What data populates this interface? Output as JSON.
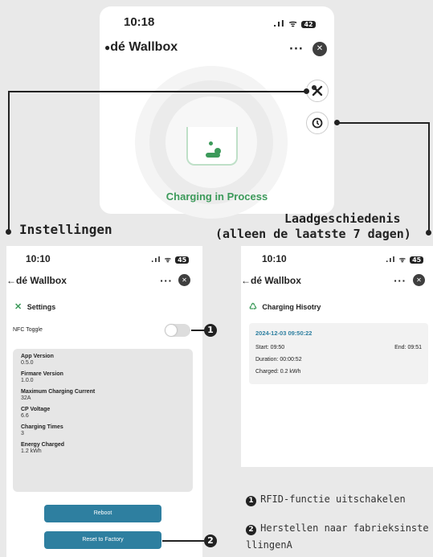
{
  "top_screen": {
    "time": "10:18",
    "battery": "42",
    "app_title": "dé Wallbox",
    "more": "···",
    "close": "✕",
    "status": "Charging in Process"
  },
  "annotations": {
    "settings_label": "Instellingen",
    "history_label_line1": "Laadgeschiedenis",
    "history_label_line2": "(alleen de laatste 7 dagen)"
  },
  "settings_screen": {
    "time": "10:10",
    "battery": "45",
    "app_title": "←dé Wallbox",
    "section_title": "Settings",
    "nfc_label": "NFC Toggle",
    "info": [
      {
        "label": "App Version",
        "value": "0.5.0"
      },
      {
        "label": "Firmare Version",
        "value": "1.0.0"
      },
      {
        "label": "Maximum Charging Current",
        "value": "32A"
      },
      {
        "label": "CP Voltage",
        "value": "6.6"
      },
      {
        "label": "Charging Times",
        "value": "3"
      },
      {
        "label": "Energy Charged",
        "value": "1.2 kWh"
      }
    ],
    "reboot_label": "Reboot",
    "reset_label": "Reset to Factory"
  },
  "history_screen": {
    "time": "10:10",
    "battery": "45",
    "app_title": "←dé Wallbox",
    "section_title": "Charging Hisotry",
    "record": {
      "date": "2024-12-03 09:50:22",
      "start": "Start: 09:50",
      "end": "End: 09:51",
      "duration": "Duration: 00:00:52",
      "charged": "Charged: 0.2 kWh"
    }
  },
  "notes": [
    {
      "num": "1",
      "text": "RFID-functie uitschakelen"
    },
    {
      "num": "2",
      "text": "Herstellen naar fabrieksinstellingenA"
    }
  ],
  "badges": {
    "one": "1",
    "two": "2"
  },
  "colors": {
    "accent_green": "#3c9a5a",
    "button_blue": "#2e7fa0",
    "panel_grey": "#e6e6e6"
  }
}
